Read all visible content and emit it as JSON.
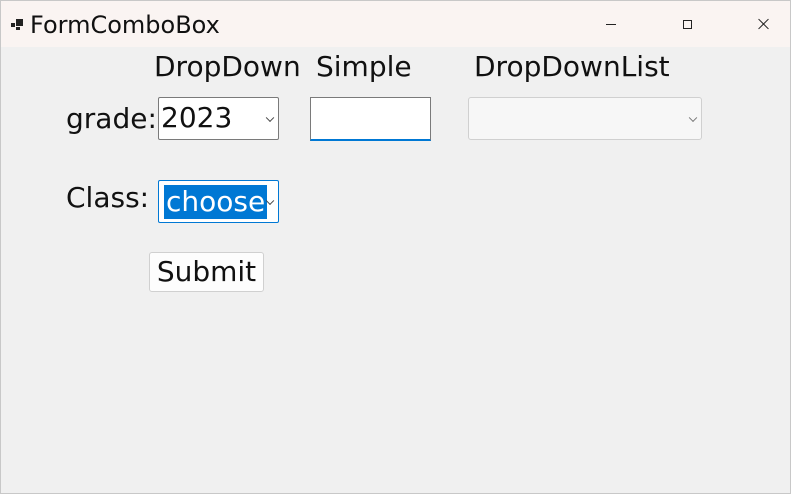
{
  "window": {
    "title": "FormComboBox",
    "icon": "app-form-icon",
    "controls": [
      "minimize-icon",
      "maximize-icon",
      "close-icon"
    ]
  },
  "headers": {
    "dropdown": "DropDown",
    "simple": "Simple",
    "dropdownlist": "DropDownList"
  },
  "form": {
    "grade_label": "grade:",
    "grade_dropdown_value": "2023",
    "grade_simple_value": "",
    "grade_dropdownlist_value": "",
    "class_label": "Class:",
    "class_value": "choose",
    "submit_label": "Submit"
  },
  "colors": {
    "accent": "#0078d4",
    "window_bg": "#f0f0f0",
    "titlebar_bg": "#faf4f2"
  }
}
